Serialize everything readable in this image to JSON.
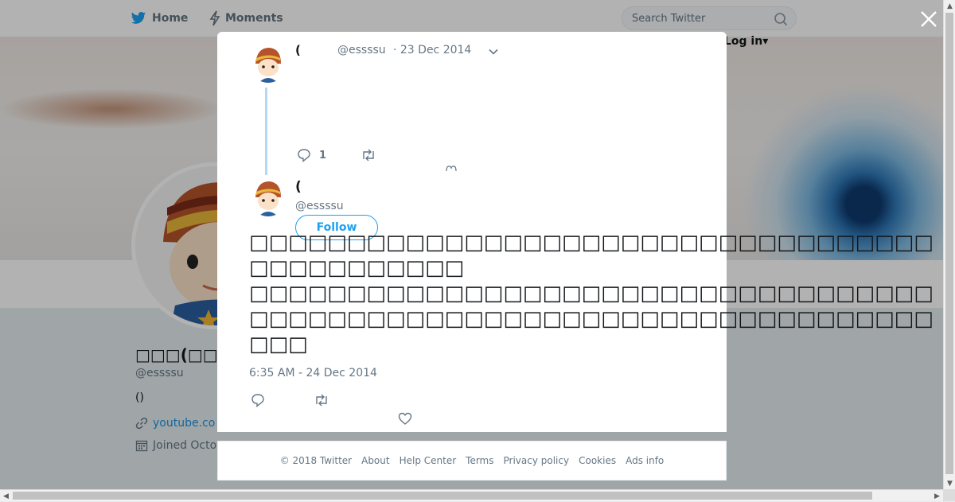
{
  "nav": {
    "home_label": "Home",
    "moments_label": "Moments",
    "search_placeholder": "Search Twitter",
    "login_label": "Log in"
  },
  "profile": {
    "name": "□□□(□□□□□",
    "handle": "@essssu",
    "bio": "()",
    "link": "youtube.co",
    "joined": "Joined Octo"
  },
  "modal": {
    "parent_tweet": {
      "name": "(",
      "handle": "@essssu",
      "date": "· 23 Dec 2014",
      "reply_count": "1"
    },
    "main_tweet": {
      "name": "(",
      "handle": "@essssu",
      "follow_label": "Follow",
      "text": "□□□□□□□□□□□□□□□□□□□□□□□□□□□□□□□□□□□□□□□□□□□□□□\n□□□□□□□□□□□□□□□□□□□□□□□□□□□□□□□□□□□□□□□□□□□□□□□□□□□□□□□□□□□□□□□□□□□□□□□□□\n\n□□□□□□□□□□□□□□□□□□□□□□□□□□□□□□□□□□□□□□□□\n□□□□□□□□□□□□",
      "timestamp": "6:35 AM - 24 Dec 2014"
    }
  },
  "footer": {
    "links": [
      "© 2018 Twitter",
      "About",
      "Help Center",
      "Terms",
      "Privacy policy",
      "Cookies",
      "Ads info"
    ]
  },
  "colors": {
    "accent": "#1da1f2",
    "link": "#1b95e0",
    "muted": "#657786"
  }
}
